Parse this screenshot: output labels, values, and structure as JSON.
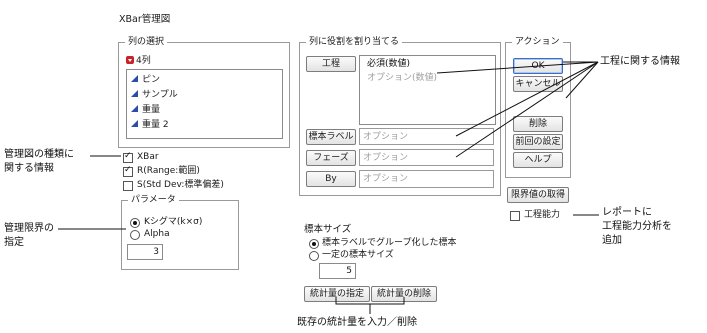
{
  "window": {
    "title": "XBar管理図"
  },
  "column_select": {
    "title": "列の選択",
    "count_label": "4列",
    "columns": [
      {
        "label": "ピン"
      },
      {
        "label": "サンプル"
      },
      {
        "label": "重量"
      },
      {
        "label": "重量 2"
      }
    ]
  },
  "chart_type": {
    "xbar": "XBar",
    "r": "R(Range:範囲)",
    "s": "S(Std Dev:標準偏差)"
  },
  "parameters": {
    "title": "パラメータ",
    "k_sigma": "Kシグマ(k×σ)",
    "alpha": "Alpha",
    "value": "3"
  },
  "roles": {
    "title": "列に役割を割り当てる",
    "process_button": "工程",
    "process_required": "必須(数値)",
    "process_optional": "オプション(数値)",
    "sample_label_button": "標本ラベル",
    "sample_label_placeholder": "オプション",
    "phase_button": "フェーズ",
    "phase_placeholder": "オプション",
    "by_button": "By",
    "by_placeholder": "オプション"
  },
  "sample_size": {
    "title": "標本サイズ",
    "group_by_label": "標本ラベルでグループ化した標本",
    "constant": "一定の標本サイズ",
    "value": "5"
  },
  "stat_buttons": {
    "specify": "統計量の指定",
    "delete": "統計量の削除"
  },
  "actions": {
    "title": "アクション",
    "ok": "OK",
    "cancel": "キャンセル",
    "remove": "削除",
    "recall": "前回の設定",
    "help": "ヘルプ"
  },
  "limits_button": "限界値の取得",
  "capability_label": "工程能力",
  "callouts": {
    "process_info": "工程に関する情報",
    "chart_type_info_line1": "管理図の種類に",
    "chart_type_info_line2": "関する情報",
    "control_limits_line1": "管理限界の",
    "control_limits_line2": "指定",
    "capability_line1": "レポートに",
    "capability_line2": "工程能力分析を",
    "capability_line3": "追加",
    "stats_bottom": "既存の統計量を入力／削除"
  }
}
